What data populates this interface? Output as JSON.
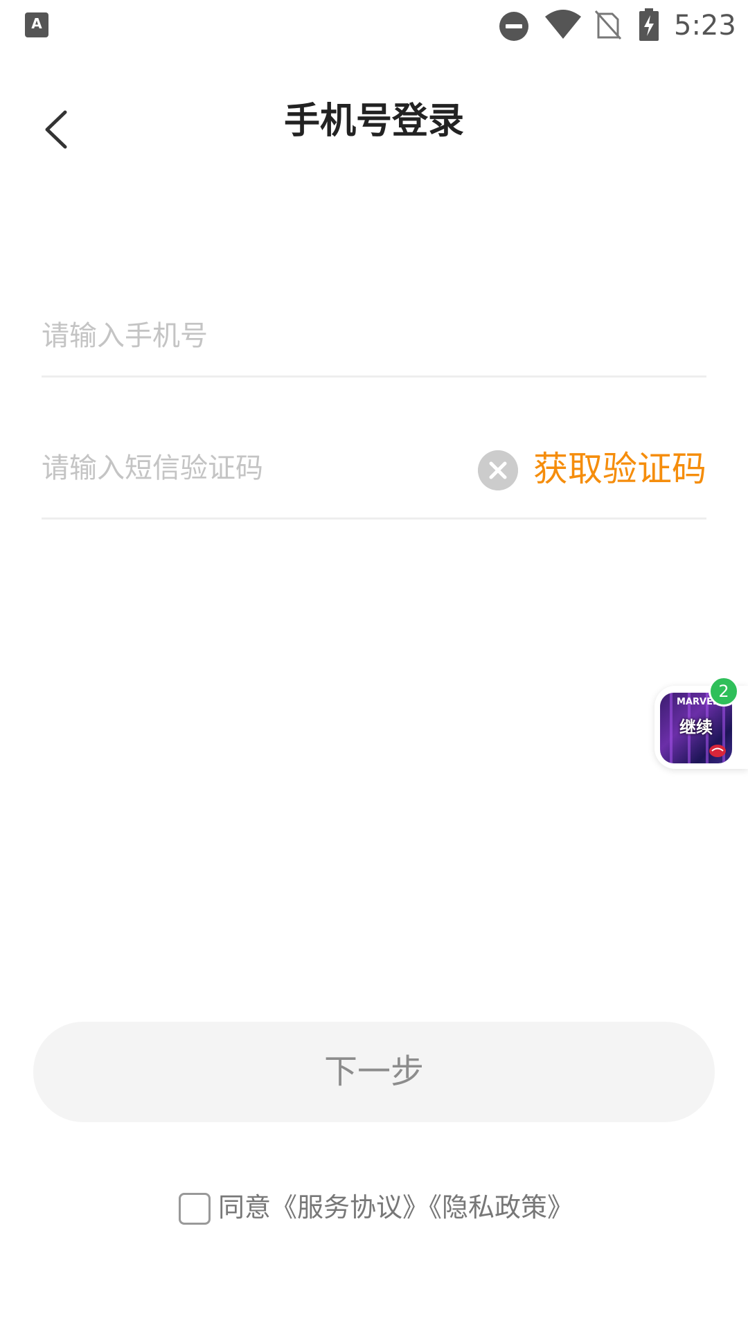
{
  "status_bar": {
    "notification_icon": "A",
    "time": "5:23"
  },
  "header": {
    "title": "手机号登录"
  },
  "form": {
    "phone_placeholder": "请输入手机号",
    "code_placeholder": "请输入短信验证码",
    "get_code_label": "获取验证码",
    "next_label": "下一步"
  },
  "floating_widget": {
    "badge_count": "2",
    "brand_text": "MARVEL",
    "label": "继续"
  },
  "agreement": {
    "prefix": "同意",
    "service_link": "《服务协议》",
    "privacy_link": "《隐私政策》"
  },
  "colors": {
    "accent": "#f58d0c",
    "badge": "#2fbf5a",
    "button_bg": "#f4f4f4"
  }
}
